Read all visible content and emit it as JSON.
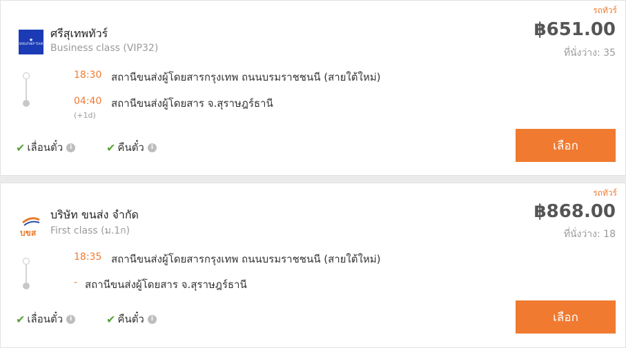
{
  "results": [
    {
      "tag": "รถทัวร์",
      "operator": "ศรีสุเทพทัวร์",
      "logo_text": "SRISUTHEP TOUR",
      "class": "Business class (VIP32)",
      "price": "฿651.00",
      "seats": "ที่นั่งว่าง: 35",
      "depart_time": "18:30",
      "depart_station": "สถานีขนส่งผู้โดยสารกรุงเทพ ถนนบรมราชชนนี (สายใต้ใหม่)",
      "arrive_time": "04:40",
      "arrive_station": "สถานีขนส่งผู้โดยสาร จ.สุราษฎร์ธานี",
      "day_offset": "(+1d)",
      "reschedule": "เลื่อนตั๋ว",
      "refund": "คืนตั๋ว",
      "select": "เลือก"
    },
    {
      "tag": "รถทัวร์",
      "operator": "บริษัท ขนส่ง จำกัด",
      "logo_text": "บขส",
      "class": "First class (ม.1ก)",
      "price": "฿868.00",
      "seats": "ที่นั่งว่าง: 18",
      "depart_time": "18:35",
      "depart_station": "สถานีขนส่งผู้โดยสารกรุงเทพ ถนนบรมราชชนนี (สายใต้ใหม่)",
      "arrive_time": "-",
      "arrive_station": "สถานีขนส่งผู้โดยสาร จ.สุราษฎร์ธานี",
      "reschedule": "เลื่อนตั๋ว",
      "refund": "คืนตั๋ว",
      "select": "เลือก"
    }
  ]
}
